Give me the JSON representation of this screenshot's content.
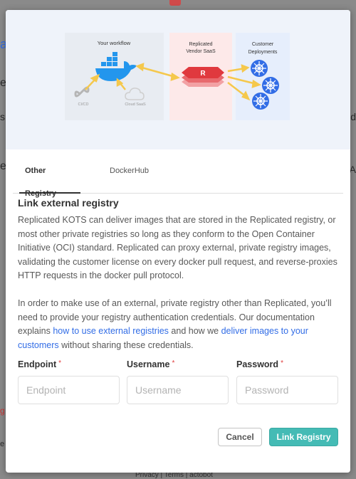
{
  "background": {
    "fragments": [
      "a",
      "e",
      "s",
      "d",
      "e",
      "A",
      "g",
      "e"
    ],
    "footer": "Privacy  |  Terms  |  actobot"
  },
  "hero": {
    "workflow_label": "Your workflow",
    "cicd_label": "CI/CD",
    "cloud_label": "Cloud SaaS",
    "vendor_label_line1": "Replicated",
    "vendor_label_line2": "Vendor SaaS",
    "customer_label_line1": "Customer",
    "customer_label_line2": "Deployments",
    "logo_letter": "R",
    "colors": {
      "workflow_panel": "#e8ecf2",
      "vendor_panel": "#fde9e9",
      "customer_panel": "#e6eefc",
      "arrow": "#f5c84c",
      "docker": "#2396ed",
      "kube": "#326de6",
      "replicated": "#e0393e"
    }
  },
  "tabs": [
    {
      "label": "Other Registry",
      "active": true
    },
    {
      "label": "DockerHub",
      "active": false
    }
  ],
  "content": {
    "title": "Link external registry",
    "para1": "Replicated KOTS can deliver images that are stored in the Replicated registry, or most other private registries so long as they conform to the Open Container Initiative (OCI) standard. Replicated can proxy external, private registry images, validating the customer license on every docker pull request, and reverse-proxies HTTP requests in the docker pull protocol.",
    "para2_a": "In order to make use of an external, private registry other than Replicated, you’ll need to provide your registry authentication credentials. Our documentation explains ",
    "para2_link1": "how to use external registries",
    "para2_b": " and how we ",
    "para2_link2": "deliver images to your customers",
    "para2_c": " without sharing these credentials."
  },
  "form": {
    "required_mark": "*",
    "endpoint": {
      "label": "Endpoint",
      "placeholder": "Endpoint",
      "value": ""
    },
    "username": {
      "label": "Username",
      "placeholder": "Username",
      "value": ""
    },
    "password": {
      "label": "Password",
      "placeholder": "Password",
      "value": ""
    }
  },
  "actions": {
    "cancel": "Cancel",
    "submit": "Link Registry"
  }
}
